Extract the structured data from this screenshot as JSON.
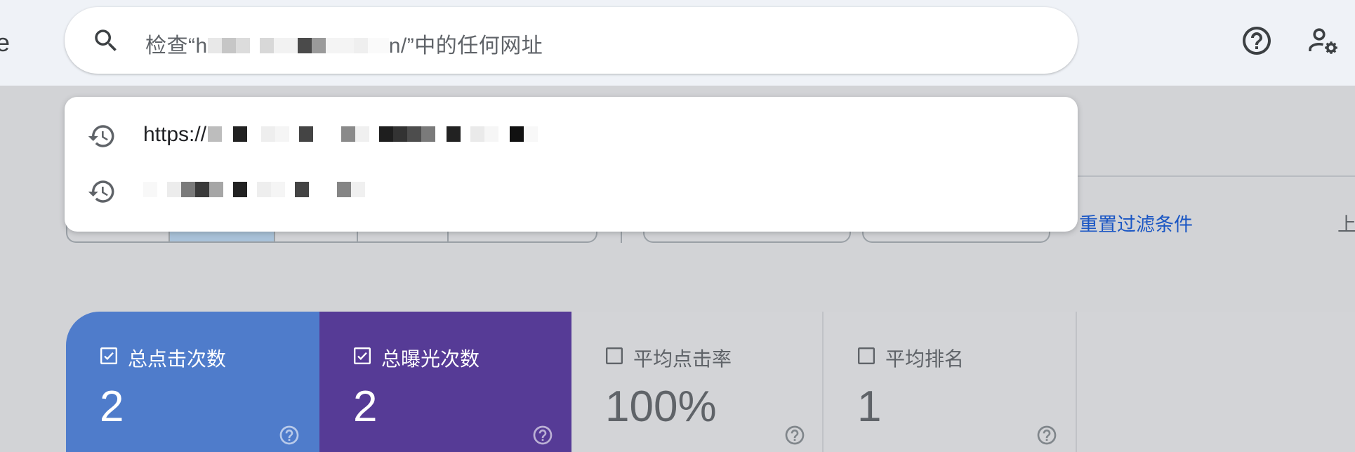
{
  "app": {
    "edge_letter": "e",
    "search": {
      "prefix": "检查“h",
      "suffix": "n/”中的任何网址"
    },
    "icons": {
      "search": "search-icon",
      "help": "help-icon",
      "admin": "admin-settings-icon",
      "history": "history-icon"
    }
  },
  "dropdown": {
    "items": [
      {
        "prefix": "https://"
      },
      {
        "prefix": ""
      }
    ]
  },
  "filters": {
    "reset_label": "重置过滤条件",
    "edge_text": "上"
  },
  "metrics": [
    {
      "label": "总点击次数",
      "value": "2",
      "checked": true,
      "color": "#4f7ccb"
    },
    {
      "label": "总曝光次数",
      "value": "2",
      "checked": true,
      "color": "#563b96"
    },
    {
      "label": "平均点击率",
      "value": "100%",
      "checked": false
    },
    {
      "label": "平均排名",
      "value": "1",
      "checked": false
    }
  ]
}
